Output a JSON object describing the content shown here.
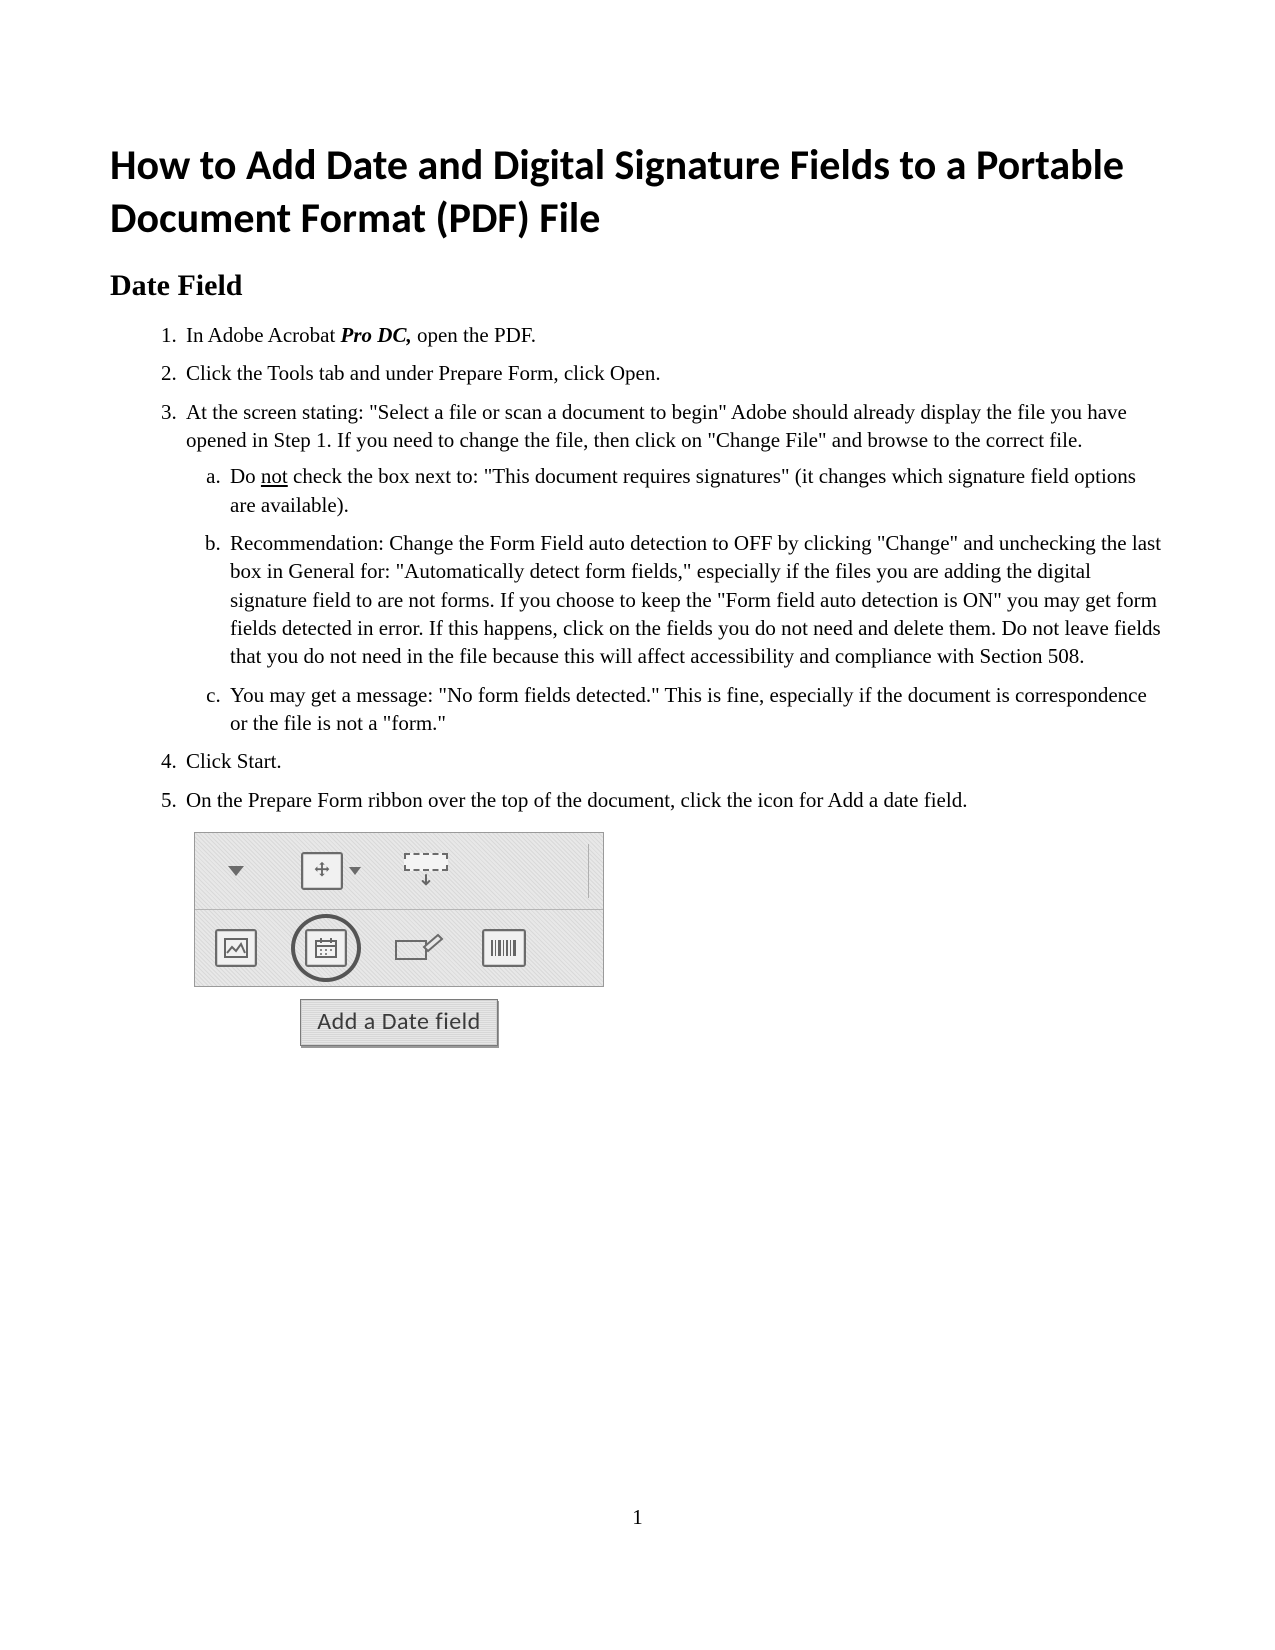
{
  "title": "How to Add Date and Digital Signature Fields to a Portable Document Format (PDF) File",
  "section_heading": "Date Field",
  "steps": {
    "s1_pre": "In Adobe Acrobat ",
    "s1_bold": "Pro DC,",
    "s1_post": " open the PDF.",
    "s2": "Click the Tools tab and under Prepare Form, click Open.",
    "s3": "At the screen stating: \"Select a file or scan a document to begin\" Adobe should already display the file you have opened in Step 1.  If you need to change the file, then click on \"Change File\" and browse to the correct file.",
    "s3a_pre": "Do ",
    "s3a_not": "not",
    "s3a_post": " check the box next to: \"This document requires signatures\" (it changes which signature field options are available).",
    "s3b": "Recommendation:  Change the Form Field auto detection to OFF by clicking \"Change\" and unchecking the last box in General for: \"Automatically detect form fields,\" especially if the files you are adding the digital signature field to are not forms.  If you choose to keep the \"Form field auto detection is ON\" you may get form fields detected in error.  If this happens, click on the fields you do not need and delete them.  Do not leave fields that you do not need in the file because this will affect accessibility and compliance with Section 508.",
    "s3c": "You may get a message: \"No form fields detected.\"  This is fine, especially if the document is correspondence or the file is not a \"form.\"",
    "s4": "Click Start.",
    "s5": "On the Prepare Form ribbon over the top of the document, click the icon for Add a date field."
  },
  "figure": {
    "tooltip_label": "Add a Date field"
  },
  "page_number": "1"
}
